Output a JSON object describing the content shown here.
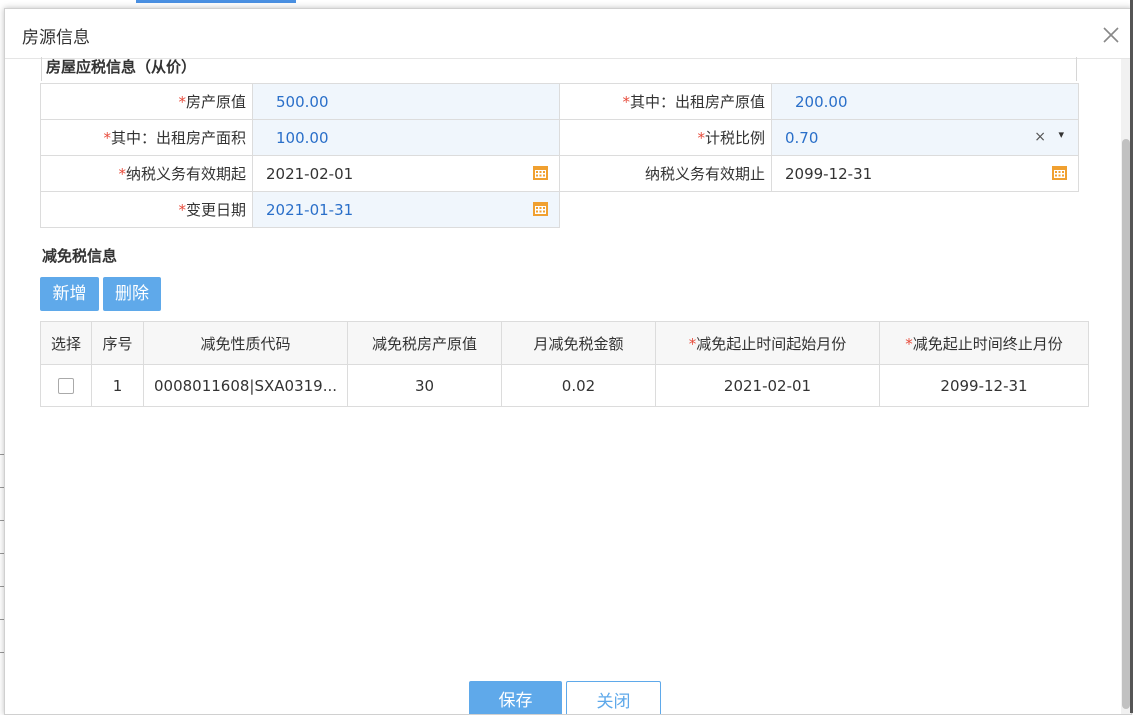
{
  "dialog": {
    "title": "房源信息"
  },
  "tax_info": {
    "title": "房屋应税信息（从价）",
    "fields": {
      "original_value": {
        "required": "*",
        "label": "房产原值",
        "value": "500.00"
      },
      "rented_original_value": {
        "required": "*",
        "label": "其中：出租房产原值",
        "value": "200.00"
      },
      "rented_area": {
        "required": "*",
        "label": "其中：出租房产面积",
        "value": "100.00"
      },
      "tax_ratio": {
        "required": "*",
        "label": "计税比例",
        "value": "0.70",
        "clear": "×",
        "caret": "▾"
      },
      "tax_start": {
        "required": "*",
        "label": "纳税义务有效期起",
        "value": "2021-02-01"
      },
      "tax_end": {
        "label": "纳税义务有效期止",
        "value": "2099-12-31"
      },
      "change_date": {
        "required": "*",
        "label": "变更日期",
        "value": "2021-01-31"
      }
    }
  },
  "relief": {
    "title": "减免税信息",
    "add_label": "新增",
    "delete_label": "删除",
    "columns": {
      "select": "选择",
      "seq": "序号",
      "code": "减免性质代码",
      "value": "减免税房产原值",
      "monthly": "月减免税金额",
      "start": "减免起止时间起始月份",
      "end": "减免起止时间终止月份",
      "required": "*"
    },
    "rows": [
      {
        "seq": "1",
        "code": "0008011608|SXA0319...",
        "value": "30",
        "monthly": "0.02",
        "start": "2021-02-01",
        "end": "2099-12-31"
      }
    ]
  },
  "footer": {
    "save_label": "保存",
    "close_label": "关闭"
  },
  "colors": {
    "accent": "#5fa9ea",
    "required": "#e74c3c",
    "value_text": "#2a6fc9",
    "calendar": "#f0a030"
  }
}
